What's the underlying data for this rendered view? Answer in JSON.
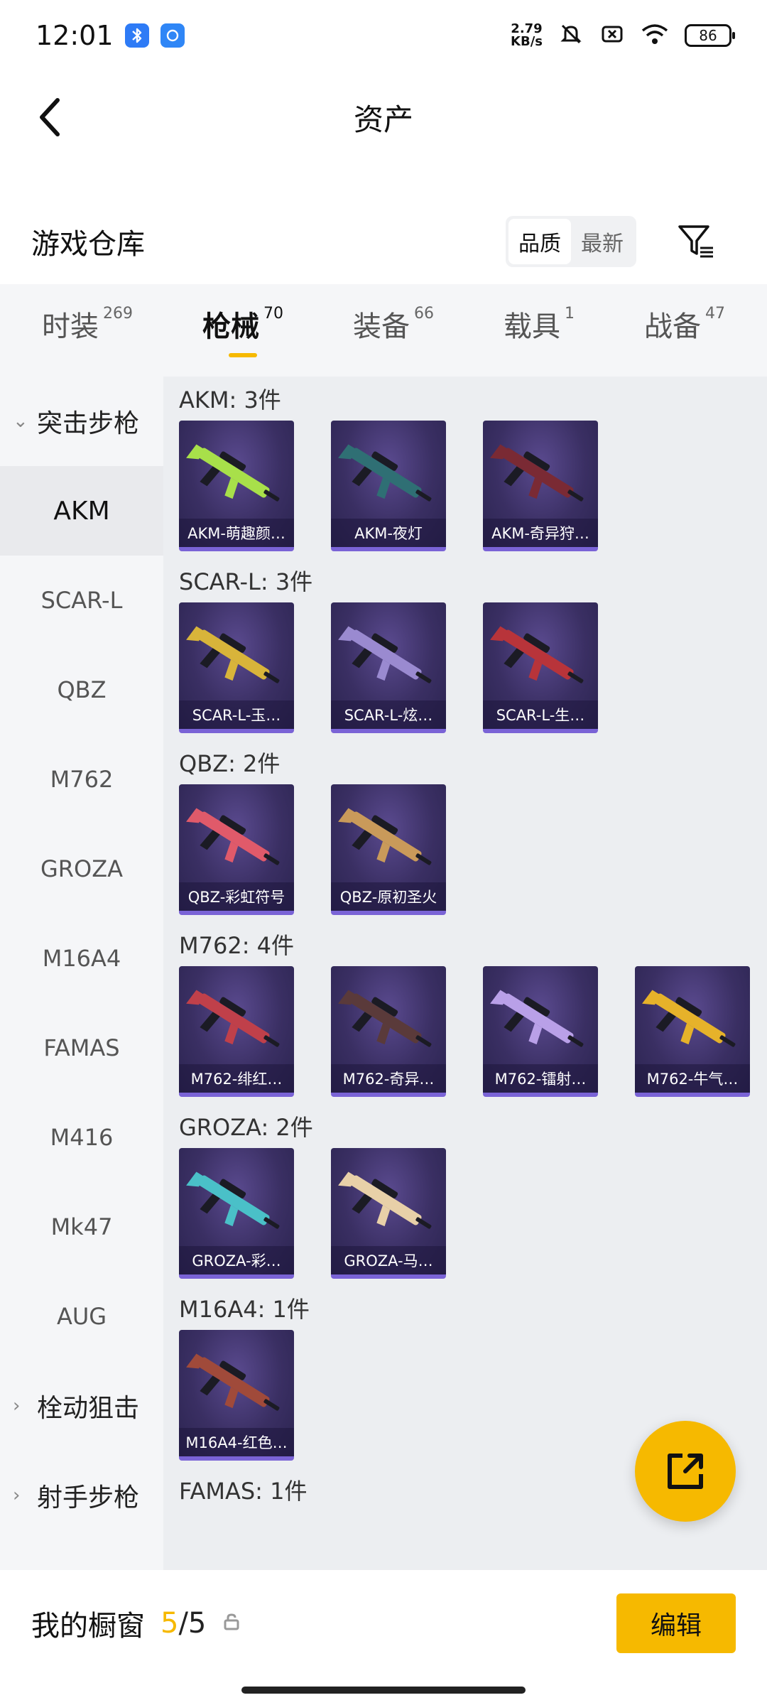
{
  "status": {
    "time": "12:01",
    "net_speed_value": "2.79",
    "net_speed_unit": "KB/s",
    "battery": "86",
    "bluetooth_color": "#2e7bf6",
    "app_color": "#2f86f6"
  },
  "header": {
    "title": "资产"
  },
  "warehouse": {
    "title": "游戏仓库",
    "sort_quality": "品质",
    "sort_newest": "最新"
  },
  "tabs": [
    {
      "label": "时装",
      "count": "269"
    },
    {
      "label": "枪械",
      "count": "70",
      "active": true
    },
    {
      "label": "装备",
      "count": "66"
    },
    {
      "label": "载具",
      "count": "1"
    },
    {
      "label": "战备",
      "count": "47"
    }
  ],
  "sidebar": {
    "group_assault": "突击步枪",
    "items": [
      "AKM",
      "SCAR-L",
      "QBZ",
      "M762",
      "GROZA",
      "M16A4",
      "FAMAS",
      "M416",
      "Mk47",
      "AUG"
    ],
    "group_bolt": "栓动狙击",
    "group_marksman": "射手步枪"
  },
  "sections": [
    {
      "title": "AKM: 3件",
      "items": [
        "AKM-萌趣颜…",
        "AKM-夜灯",
        "AKM-奇异狩…"
      ]
    },
    {
      "title": "SCAR-L: 3件",
      "items": [
        "SCAR-L-玉…",
        "SCAR-L-炫…",
        "SCAR-L-生…"
      ]
    },
    {
      "title": "QBZ: 2件",
      "items": [
        "QBZ-彩虹符号",
        "QBZ-原初圣火"
      ]
    },
    {
      "title": "M762: 4件",
      "items": [
        "M762-绯红…",
        "M762-奇异…",
        "M762-镭射…",
        "M762-牛气…"
      ]
    },
    {
      "title": "GROZA: 2件",
      "items": [
        "GROZA-彩…",
        "GROZA-马…"
      ]
    },
    {
      "title": "M16A4: 1件",
      "items": [
        "M16A4-红色…"
      ]
    },
    {
      "title": "FAMAS: 1件",
      "items": []
    }
  ],
  "weapon_colors": [
    "#a8e04a",
    "#2f6f74",
    "#7a2a34",
    "#d8b43a",
    "#9a8ad0",
    "#b8343a",
    "#e05a6a",
    "#c99a5a",
    "#c0404a",
    "#5a3a3a",
    "#b9a0e8",
    "#e6b22a",
    "#4ac0c8",
    "#e8d0a8",
    "#a04a3a"
  ],
  "bottom": {
    "showcase_label": "我的橱窗",
    "current": "5",
    "total": "/5",
    "edit_label": "编辑"
  }
}
